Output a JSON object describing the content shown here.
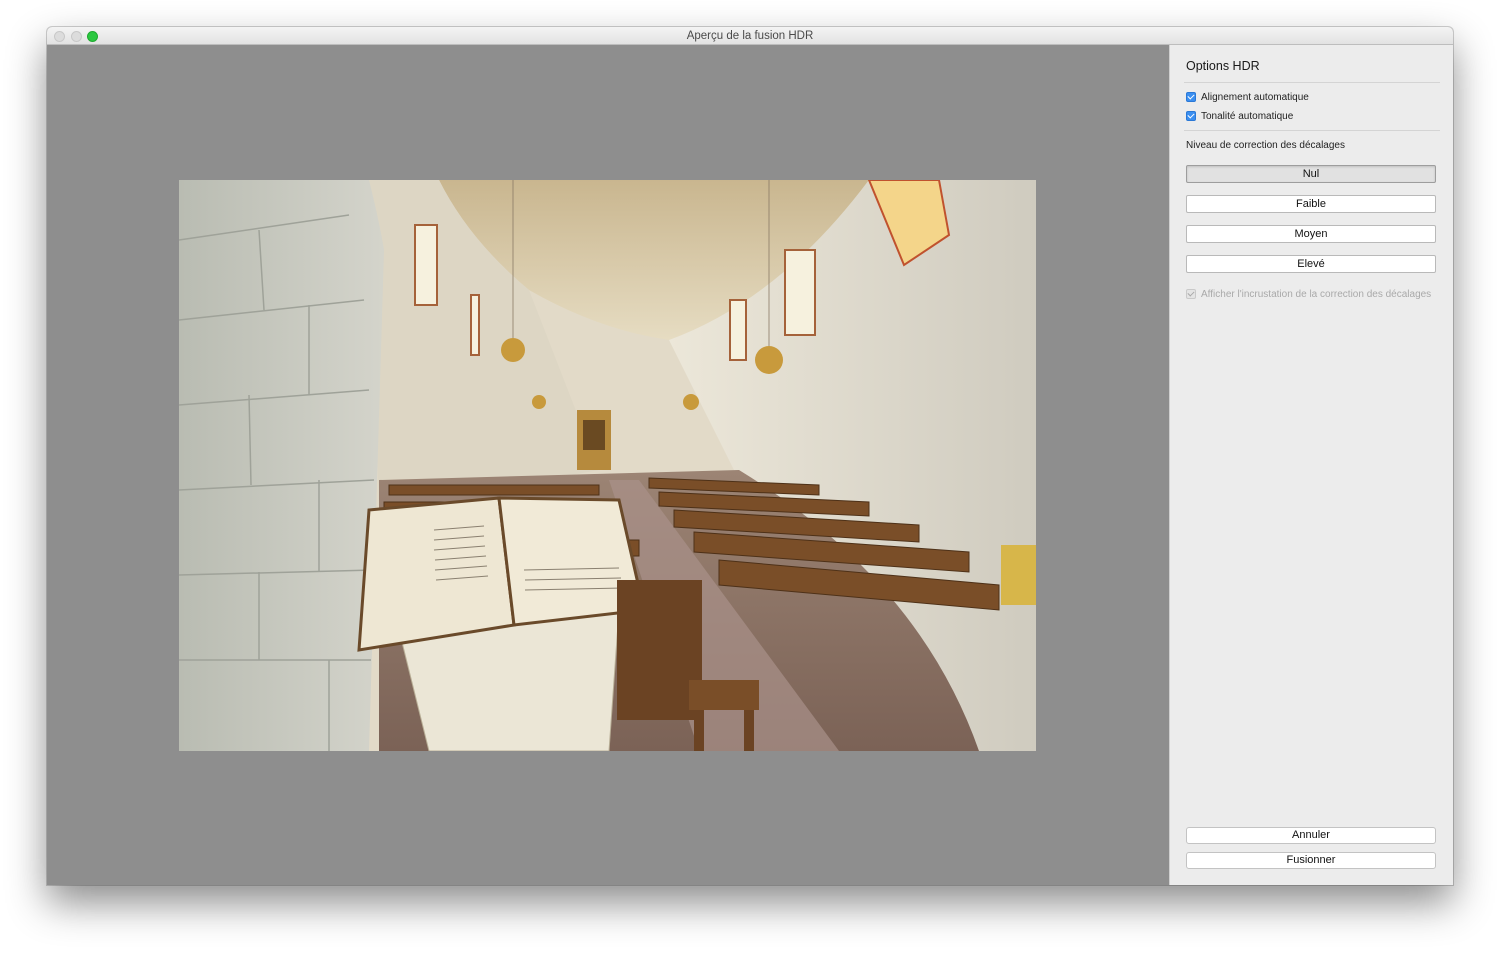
{
  "window": {
    "title": "Aperçu de la fusion HDR"
  },
  "preview": {
    "image_description": "HDR merge preview photo"
  },
  "panel": {
    "title": "Options HDR",
    "options": [
      {
        "label": "Alignement automatique",
        "checked": true
      },
      {
        "label": "Tonalité automatique",
        "checked": true
      }
    ],
    "deghost": {
      "label": "Niveau de correction des décalages",
      "levels": [
        "Nul",
        "Faible",
        "Moyen",
        "Elevé"
      ],
      "selected": "Nul",
      "overlay_label": "Afficher l'incrustation de la correction des décalages",
      "overlay_checked": true,
      "overlay_enabled": false
    },
    "buttons": {
      "cancel": "Annuler",
      "merge": "Fusionner"
    }
  },
  "colors": {
    "checkbox_blue": "#3b8ff0",
    "zoom_green": "#2bc840",
    "preview_bg": "#8e8e8e"
  }
}
